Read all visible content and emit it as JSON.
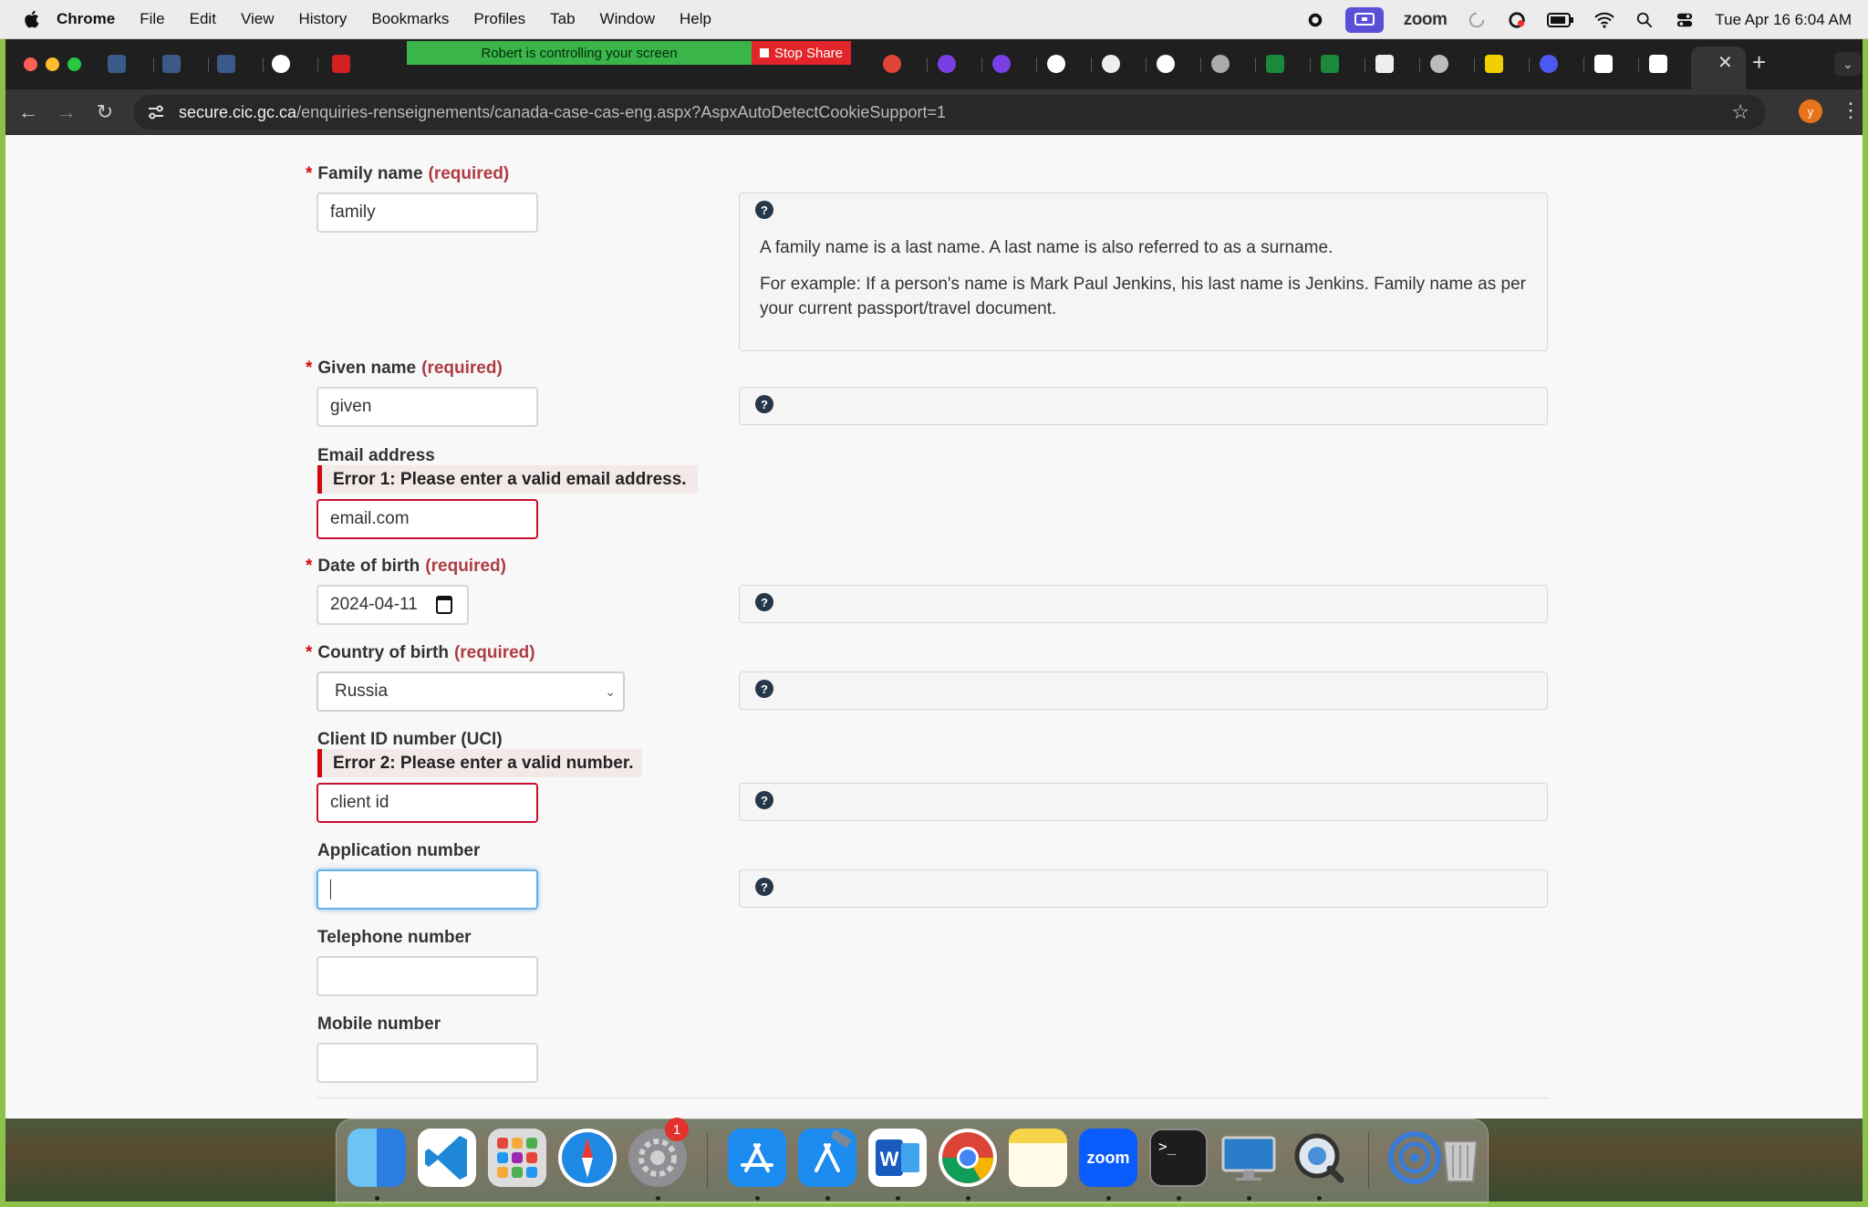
{
  "menubar": {
    "app": "Chrome",
    "items": [
      "File",
      "Edit",
      "View",
      "History",
      "Bookmarks",
      "Profiles",
      "Tab",
      "Window",
      "Help"
    ],
    "zoom_label": "zoom",
    "clock": "Tue Apr 16  6:04 AM"
  },
  "zoom_banner": {
    "controlling_text": "Robert is controlling your screen",
    "stop_label": "Stop Share"
  },
  "toolbar": {
    "url_host": "secure.cic.gc.ca",
    "url_path": "/enquiries-renseignements/canada-case-cas-eng.aspx?AspxAutoDetectCookieSupport=1",
    "profile_initial": "y"
  },
  "form": {
    "required_marker": "*",
    "required_suffix": "(required)",
    "family_name": {
      "label": "Family name",
      "value": "family",
      "help_line1": "A family name is a last name. A last name is also referred to as a surname.",
      "help_line2": "For example: If a person's name is Mark Paul Jenkins, his last name is Jenkins. Family name as per your current passport/travel document."
    },
    "given_name": {
      "label": "Given name",
      "value": "given"
    },
    "email": {
      "label": "Email address",
      "error": "Error 1: Please enter a valid email address.",
      "value": "email.com"
    },
    "dob": {
      "label": "Date of birth",
      "value": "2024-04-11"
    },
    "country": {
      "label": "Country of birth",
      "value": "Russia"
    },
    "uci": {
      "label": "Client ID number (UCI)",
      "error": "Error 2: Please enter a valid number.",
      "value": "client id"
    },
    "application": {
      "label": "Application number",
      "value": ""
    },
    "telephone": {
      "label": "Telephone number",
      "value": ""
    },
    "mobile": {
      "label": "Mobile number",
      "value": ""
    },
    "help_glyph": "?"
  },
  "dock": {
    "settings_badge": "1",
    "zoom_label": "zoom",
    "terminal_prompt": ">_"
  },
  "colors": {
    "required_red": "#d3080c",
    "required_text": "#af3c43",
    "error_border": "#c8102e",
    "focus_blue": "#66afe9",
    "help_icon": "#26374a"
  }
}
